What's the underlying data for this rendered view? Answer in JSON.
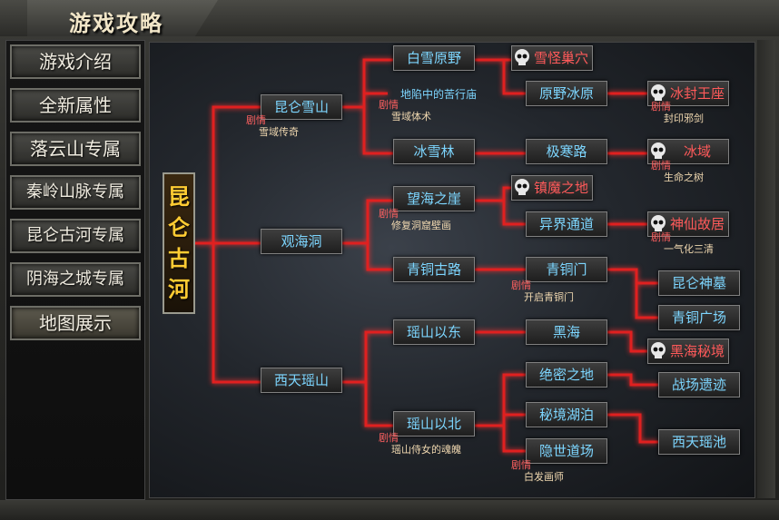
{
  "title": "游戏攻略",
  "sidebar": {
    "items": [
      {
        "label": "游戏介绍"
      },
      {
        "label": "全新属性"
      },
      {
        "label": "落云山专属"
      },
      {
        "label": "秦岭山脉专属"
      },
      {
        "label": "昆仑古河专属"
      },
      {
        "label": "阴海之城专属"
      },
      {
        "label": "地图展示"
      }
    ]
  },
  "map": {
    "root": "昆仑古河",
    "plot_tag": "剧情",
    "nodes": {
      "kunlun_xueshan": "昆仑雪山",
      "guanhai_dong": "观海洞",
      "xitian_yaoshan": "西天瑶山",
      "baixue_yuanye": "白雪原野",
      "dixian_kuxing": "地陷中的苦行庙",
      "bingxue_lin": "冰雪林",
      "wanghai_ya": "望海之崖",
      "qingtong_gulu": "青铜古路",
      "yaoshan_yidong": "瑶山以东",
      "yaoshan_yibei": "瑶山以北",
      "xueguai_chaoxue": "雪怪巢穴",
      "yuanye_bingyuan": "原野冰原",
      "jihan_lu": "极寒路",
      "zhenmo_zhidi": "镇魔之地",
      "yijie_tongdao": "异界通道",
      "qingtong_men": "青铜门",
      "hei_hai": "黑海",
      "juemi_zhidi": "绝密之地",
      "mijing_hubo": "秘境湖泊",
      "yinshi_daochang": "隐世道场",
      "bingfeng_wangzuo": "冰封王座",
      "bing_yu": "冰域",
      "shenxian_guju": "神仙故居",
      "kunlun_shenmu": "昆仑神墓",
      "qingtong_guangchang": "青铜广场",
      "heihai_mijing": "黑海秘境",
      "zhanchang_yiji": "战场遗迹",
      "xitian_yaochi": "西天瑶池"
    },
    "plots": {
      "kunlun_xueshan": "雪域传奇",
      "dixian_kuxing": "雪域体术",
      "wanghai_ya": "修复洞窟壁画",
      "qingtong_men": "开启青铜门",
      "yaoshan_yibei": "瑶山侍女的魂魄",
      "yinshi_daochang": "白发画师",
      "bingfeng_wangzuo": "封印邪剑",
      "bing_yu": "生命之树",
      "shenxian_guju": "一气化三清"
    },
    "colors": {
      "link": "#e02020",
      "node_text": "#7dd6ff",
      "red_node_text": "#ff5a5a",
      "root_text": "#ffcc33"
    },
    "icons": {
      "boss": "skull-icon"
    }
  }
}
